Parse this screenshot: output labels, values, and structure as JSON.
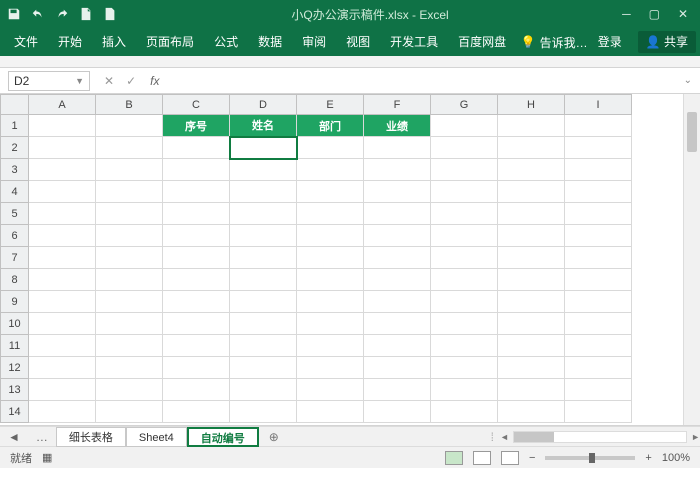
{
  "title": "小Q办公演示稿件.xlsx - Excel",
  "tabs": [
    "文件",
    "开始",
    "插入",
    "页面布局",
    "公式",
    "数据",
    "审阅",
    "视图",
    "开发工具",
    "百度网盘"
  ],
  "tellme": "告诉我…",
  "login": "登录",
  "share": "共享",
  "namebox": "D2",
  "columns": [
    "A",
    "B",
    "C",
    "D",
    "E",
    "F",
    "G",
    "H",
    "I"
  ],
  "rows": [
    "1",
    "2",
    "3",
    "4",
    "5",
    "6",
    "7",
    "8",
    "9",
    "10",
    "11",
    "12",
    "13",
    "14"
  ],
  "headers": {
    "C1": "序号",
    "D1": "姓名",
    "E1": "部门",
    "F1": "业绩"
  },
  "sheets": {
    "nav": "…",
    "s1": "细长表格",
    "s2": "Sheet4",
    "s3": "自动编号"
  },
  "status": {
    "ready": "就绪",
    "zoom": "100%"
  }
}
